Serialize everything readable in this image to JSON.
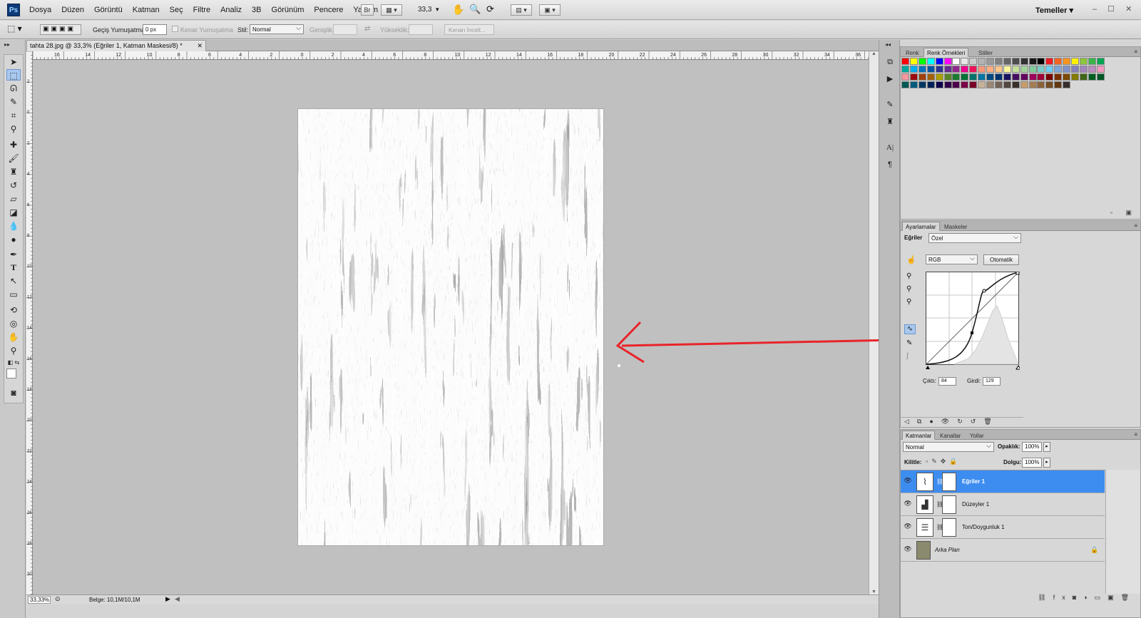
{
  "app": {
    "logo": "Ps",
    "menu": [
      "Dosya",
      "Düzen",
      "Görüntü",
      "Katman",
      "Seç",
      "Filtre",
      "Analiz",
      "3B",
      "Görünüm",
      "Pencere",
      "Yardım"
    ],
    "bridge": "Br",
    "zoom": "33,3",
    "workspace": "Temeller",
    "window_controls": "– ☐ ✕"
  },
  "options": {
    "feather_label": "Geçiş Yumuşatma:",
    "feather_value": "0 px",
    "antialias": "Kenar Yumuşatma",
    "style_label": "Stil:",
    "style_value": "Normal",
    "width_label": "Genişlik:",
    "height_label": "Yükseklik:",
    "refine": "Kenarı İncelt..."
  },
  "document": {
    "tab_title": "tahta 28.jpg @ 33,3% (Eğriler 1, Katman Maskesi/8) *",
    "close": "✕",
    "ruler_h": [
      "16",
      "14",
      "12",
      "10",
      "8",
      "6",
      "4",
      "2",
      "0",
      "2",
      "4",
      "6",
      "8",
      "10",
      "12",
      "14",
      "16",
      "18",
      "20",
      "22",
      "24",
      "26",
      "28",
      "30",
      "32",
      "34",
      "36"
    ],
    "ruler_v": [
      "2",
      "0",
      "2",
      "4",
      "6",
      "8",
      "10",
      "12",
      "14",
      "16",
      "18",
      "20",
      "22",
      "24",
      "26",
      "28",
      "30",
      "32"
    ]
  },
  "status": {
    "zoom": "33,33%",
    "doc": "Belge: 10,1M/10,1M"
  },
  "swatches": {
    "tabs": [
      "Renk",
      "Renk Örnekleri",
      "Stiller"
    ],
    "colors": [
      "#ff0000",
      "#ffff00",
      "#00ff00",
      "#00ffff",
      "#0000ff",
      "#ff00ff",
      "#ffffff",
      "#e6e6e6",
      "#cccccc",
      "#b3b3b3",
      "#999999",
      "#808080",
      "#666666",
      "#4d4d4d",
      "#333333",
      "#1a1a1a",
      "#000000",
      "#ed1c24",
      "#f26522",
      "#f7941d",
      "#fff200",
      "#8dc63f",
      "#39b54a",
      "#00a651",
      "#00a99d",
      "#00aeef",
      "#0072bc",
      "#0054a6",
      "#2e3192",
      "#662d91",
      "#92278f",
      "#ec008c",
      "#ed145b",
      "#f69679",
      "#f9ad81",
      "#fdc68a",
      "#fff799",
      "#c4df9b",
      "#a3d39c",
      "#82ca9c",
      "#7accc8",
      "#6dcff6",
      "#7da7d9",
      "#8393ca",
      "#8781bd",
      "#a187be",
      "#bc8dbf",
      "#f49ac2",
      "#f6989d",
      "#9e0b0f",
      "#a0410d",
      "#a3620a",
      "#aba000",
      "#598527",
      "#1a7b30",
      "#007236",
      "#00746b",
      "#0076a3",
      "#004a80",
      "#003471",
      "#1b1464",
      "#440e62",
      "#630460",
      "#9e005d",
      "#9e0039",
      "#790000",
      "#7b2e00",
      "#7d4900",
      "#827b00",
      "#406618",
      "#005e20",
      "#005826",
      "#005952",
      "#005b7f",
      "#003663",
      "#002157",
      "#0d004c",
      "#32004b",
      "#4b0049",
      "#7b0046",
      "#7a0026",
      "#c7b299",
      "#998675",
      "#736357",
      "#534741",
      "#37302a",
      "#c69c6d",
      "#a67c52",
      "#8c6239",
      "#754c24",
      "#603913",
      "#362f2d"
    ]
  },
  "adjustments": {
    "tabs": [
      "Ayarlamalar",
      "Maskeler"
    ],
    "title": "Eğriler",
    "preset": "Özel",
    "channel": "RGB",
    "auto": "Otomatik",
    "output_label": "Çıktı:",
    "output_value": "84",
    "input_label": "Girdi:",
    "input_value": "129"
  },
  "layers": {
    "tabs": [
      "Katmanlar",
      "Kanallar",
      "Yollar"
    ],
    "blend": "Normal",
    "opacity_label": "Opaklık:",
    "opacity_value": "100%",
    "lock_label": "Kilitle:",
    "fill_label": "Dolgu:",
    "fill_value": "100%",
    "items": [
      {
        "name": "Eğriler 1",
        "active": true,
        "icon": "curves-icon"
      },
      {
        "name": "Düzeyler 1",
        "active": false,
        "icon": "levels-icon"
      },
      {
        "name": "Ton/Doygunluk 1",
        "active": false,
        "icon": "hue-saturation-icon"
      },
      {
        "name": "Arka Plan",
        "active": false,
        "icon": "lock-icon"
      }
    ]
  },
  "colors": {
    "selection": "#3d8cf0",
    "annotation": "#e8242a"
  }
}
